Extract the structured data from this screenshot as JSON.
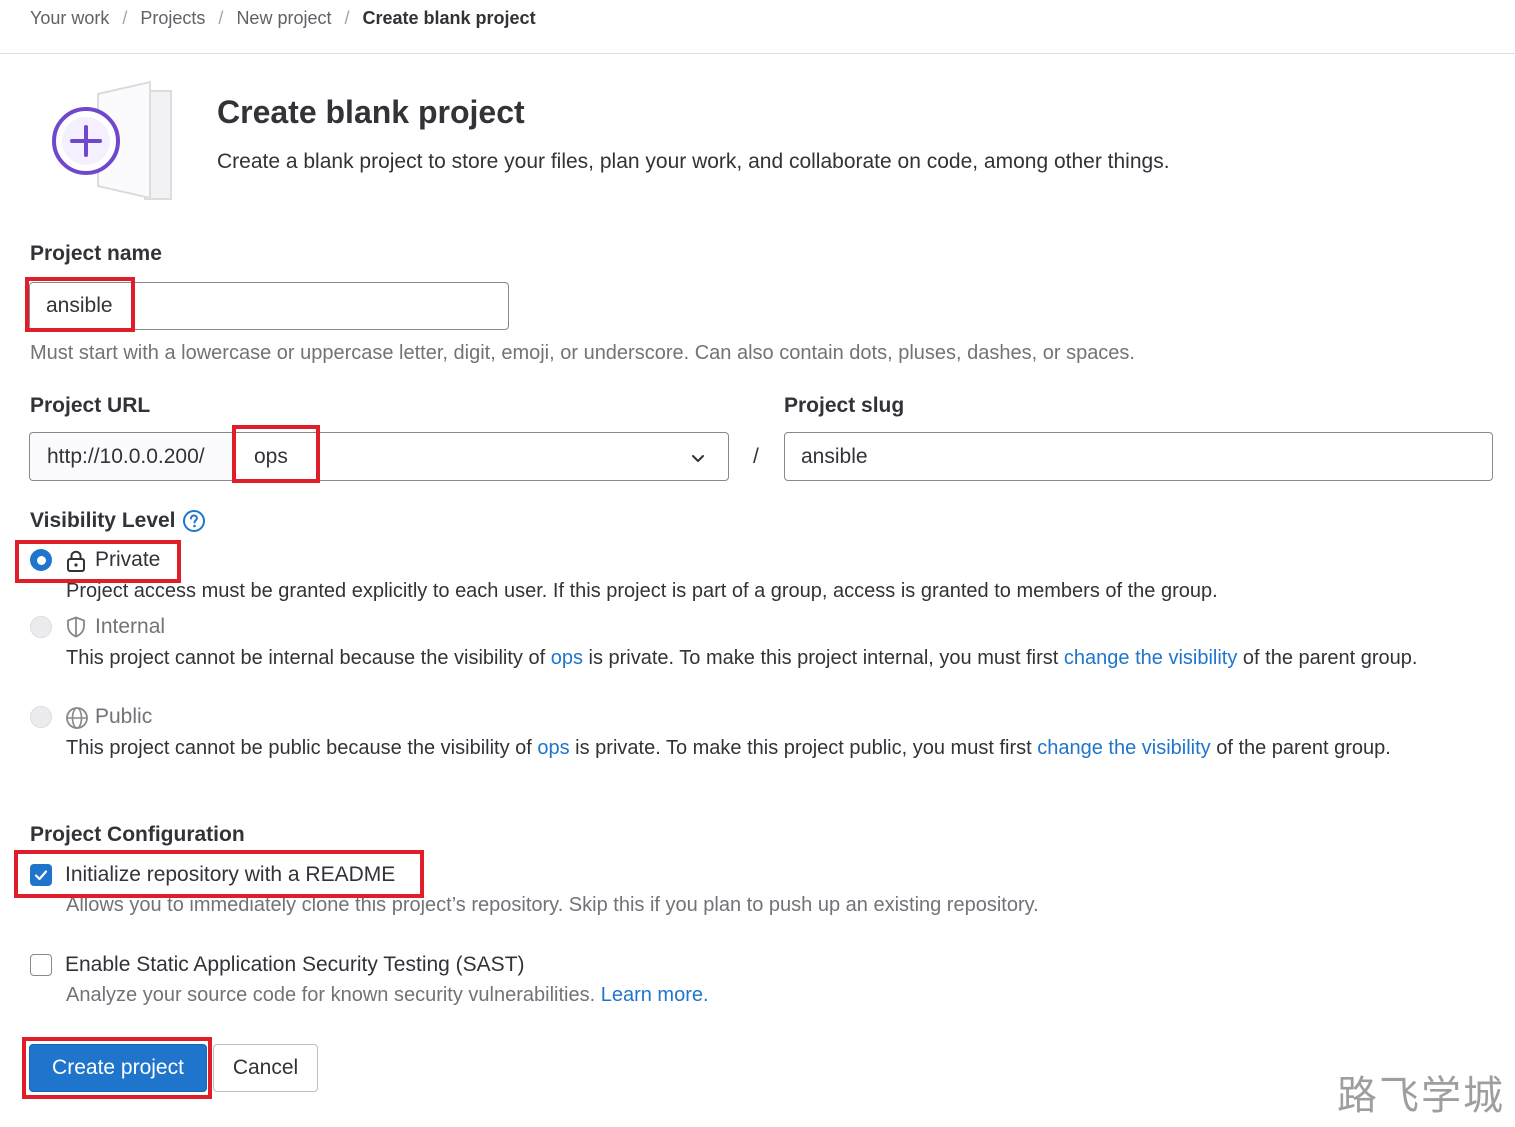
{
  "breadcrumb": {
    "items": [
      "Your work",
      "Projects",
      "New project"
    ],
    "separator": "/",
    "current": "Create blank project"
  },
  "header": {
    "title": "Create blank project",
    "description": "Create a blank project to store your files, plan your work, and collaborate on code, among other things."
  },
  "project_name": {
    "label": "Project name",
    "value": "ansible",
    "help": "Must start with a lowercase or uppercase letter, digit, emoji, or underscore. Can also contain dots, pluses, dashes, or spaces."
  },
  "project_url": {
    "label": "Project URL",
    "prefix": "http://10.0.0.200/",
    "namespace": "ops",
    "separator": "/"
  },
  "project_slug": {
    "label": "Project slug",
    "value": "ansible"
  },
  "visibility": {
    "label": "Visibility Level",
    "help_icon": "question-circle-icon",
    "options": [
      {
        "label": "Private",
        "icon": "lock-icon",
        "selected": true,
        "enabled": true,
        "description": "Project access must be granted explicitly to each user. If this project is part of a group, access is granted to members of the group."
      },
      {
        "label": "Internal",
        "icon": "shield-icon",
        "selected": false,
        "enabled": false,
        "desc_pre": "This project cannot be internal because the visibility of ",
        "desc_group": "ops",
        "desc_mid": " is private. To make this project internal, you must first ",
        "desc_link": "change the visibility",
        "desc_post": " of the parent group."
      },
      {
        "label": "Public",
        "icon": "globe-icon",
        "selected": false,
        "enabled": false,
        "desc_pre": "This project cannot be public because the visibility of ",
        "desc_group": "ops",
        "desc_mid": " is private. To make this project public, you must first ",
        "desc_link": "change the visibility",
        "desc_post": " of the parent group."
      }
    ]
  },
  "configuration": {
    "label": "Project Configuration",
    "readme": {
      "label": "Initialize repository with a README",
      "checked": true,
      "description": "Allows you to immediately clone this project’s repository. Skip this if you plan to push up an existing repository."
    },
    "sast": {
      "label": "Enable Static Application Security Testing (SAST)",
      "checked": false,
      "description": "Analyze your source code for known security vulnerabilities. ",
      "link": "Learn more."
    }
  },
  "actions": {
    "create": "Create project",
    "cancel": "Cancel"
  },
  "watermark": "路飞学城",
  "colors": {
    "primary": "#1f75cb",
    "annotation_red": "#e01e2a",
    "illustration_purple": "#6e49cb"
  }
}
